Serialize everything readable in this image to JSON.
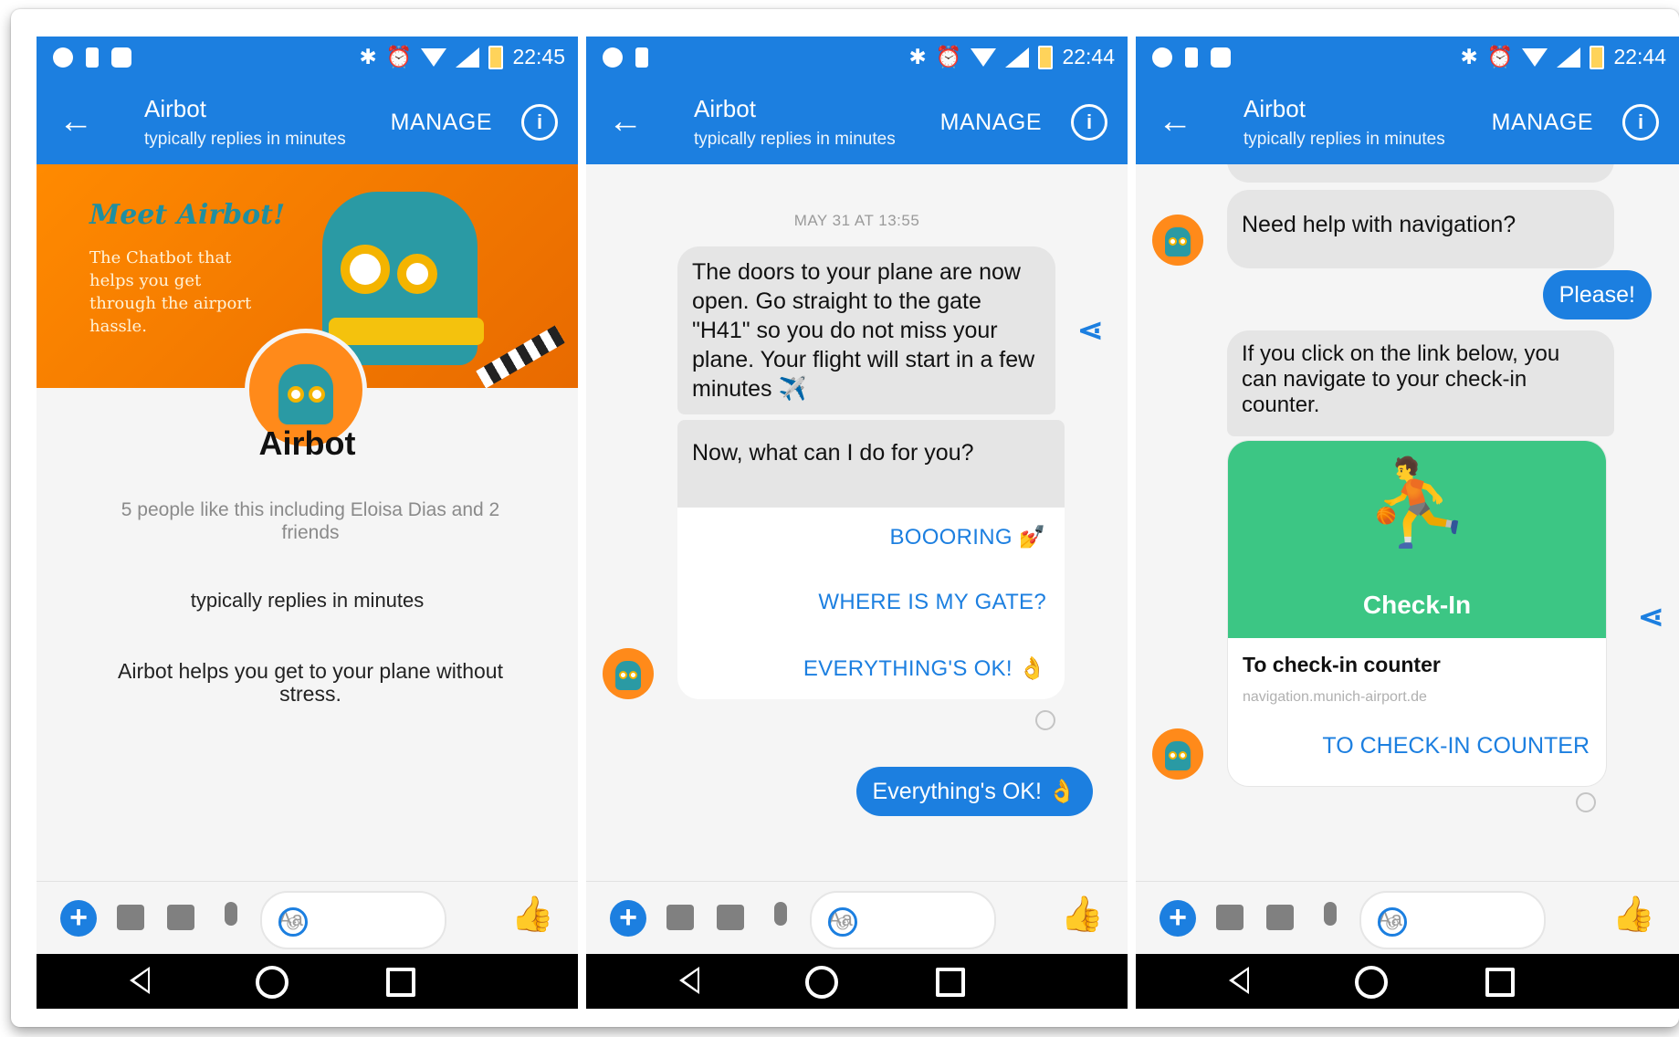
{
  "status_bars": [
    {
      "time": "22:45"
    },
    {
      "time": "22:44"
    },
    {
      "time": "22:44"
    }
  ],
  "header": {
    "title": "Airbot",
    "subtitle": "typically replies in minutes",
    "manage_label": "MANAGE",
    "back_icon": "arrow-left-icon",
    "info_icon": "info-icon"
  },
  "profile": {
    "banner_title": "Meet Airbot!",
    "banner_text": "The Chatbot that helps you get through the airport hassle.",
    "name": "Airbot",
    "likes": "5 people like this including Eloisa Dias and 2 friends",
    "replies": "typically replies in minutes",
    "description": "Airbot helps you get to your plane without stress."
  },
  "chat2": {
    "timestamp": "MAY 31 AT 13:55",
    "message1": "The doors to your plane are now open. Go straight to the gate \"H41\" so you do not miss your plane. Your flight will start in a few minutes ✈️",
    "message2": "Now, what can I do for you?",
    "quick_replies": [
      "BOOORING 💅",
      "WHERE IS MY GATE?",
      "EVERYTHING'S OK! 👌"
    ],
    "user_reply": "Everything's OK! 👌"
  },
  "chat3": {
    "message1": "Need help with navigation?",
    "user_reply": "Please!",
    "message2": "If you click on the link below, you can navigate to your check-in counter.",
    "card": {
      "image_label": "Check-In",
      "title": "To check-in counter",
      "domain": "navigation.munich-airport.de",
      "button": "TO CHECK-IN COUNTER"
    }
  },
  "composer": {
    "placeholder": "Aa",
    "icons": [
      "plus-icon",
      "camera-icon",
      "image-icon",
      "mic-icon",
      "emoji-icon",
      "thumbs-up-icon"
    ]
  },
  "colors": {
    "brand_blue": "#1c7fe0",
    "banner_orange": "#ff8a00",
    "checkin_green": "#3cc684"
  }
}
